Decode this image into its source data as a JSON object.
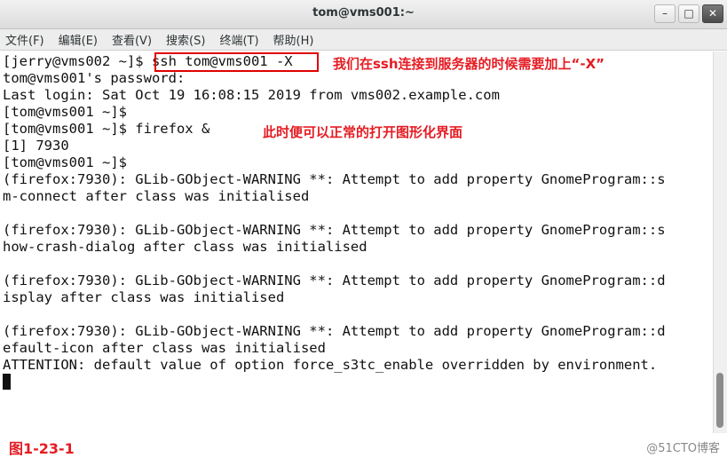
{
  "window": {
    "title": "tom@vms001:~",
    "buttons": {
      "minimize": "–",
      "maximize": "□",
      "close": "✕"
    }
  },
  "menu": [
    "文件(F)",
    "编辑(E)",
    "查看(V)",
    "搜索(S)",
    "终端(T)",
    "帮助(H)"
  ],
  "terminal_lines": [
    "[jerry@vms002 ~]$ ssh tom@vms001 -X",
    "tom@vms001's password:",
    "Last login: Sat Oct 19 16:08:15 2019 from vms002.example.com",
    "[tom@vms001 ~]$",
    "[tom@vms001 ~]$ firefox &",
    "[1] 7930",
    "[tom@vms001 ~]$",
    "(firefox:7930): GLib-GObject-WARNING **: Attempt to add property GnomeProgram::s",
    "m-connect after class was initialised",
    "",
    "(firefox:7930): GLib-GObject-WARNING **: Attempt to add property GnomeProgram::s",
    "how-crash-dialog after class was initialised",
    "",
    "(firefox:7930): GLib-GObject-WARNING **: Attempt to add property GnomeProgram::d",
    "isplay after class was initialised",
    "",
    "(firefox:7930): GLib-GObject-WARNING **: Attempt to add property GnomeProgram::d",
    "efault-icon after class was initialised",
    "ATTENTION: default value of option force_s3tc_enable overridden by environment."
  ],
  "annotations": {
    "ssh_note": "我们在ssh连接到服务器的时候需要加上“-X”",
    "firefox_note": "此时便可以正常的打开图形化界面"
  },
  "figure_label": "图1-23-1",
  "watermark": "@51CTO博客",
  "colors": {
    "annotation": "#e51c23",
    "highlight_box": "#e00000"
  }
}
